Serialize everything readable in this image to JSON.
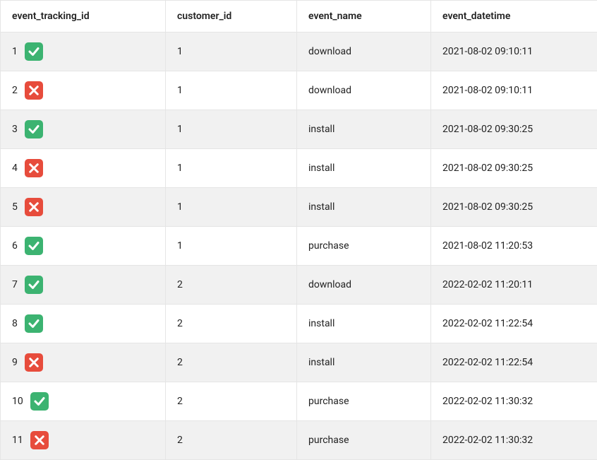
{
  "icons": {
    "check": "check-icon",
    "cross": "cross-icon"
  },
  "table": {
    "headers": [
      "event_tracking_id",
      "customer_id",
      "event_name",
      "event_datetime"
    ],
    "rows": [
      {
        "id": "1",
        "status": "check",
        "customer_id": "1",
        "event_name": "download",
        "event_datetime": "2021-08-02 09:10:11"
      },
      {
        "id": "2",
        "status": "cross",
        "customer_id": "1",
        "event_name": "download",
        "event_datetime": "2021-08-02 09:10:11"
      },
      {
        "id": "3",
        "status": "check",
        "customer_id": "1",
        "event_name": "install",
        "event_datetime": "2021-08-02 09:30:25"
      },
      {
        "id": "4",
        "status": "cross",
        "customer_id": "1",
        "event_name": "install",
        "event_datetime": "2021-08-02 09:30:25"
      },
      {
        "id": "5",
        "status": "cross",
        "customer_id": "1",
        "event_name": "install",
        "event_datetime": "2021-08-02 09:30:25"
      },
      {
        "id": "6",
        "status": "check",
        "customer_id": "1",
        "event_name": "purchase",
        "event_datetime": "2021-08-02 11:20:53"
      },
      {
        "id": "7",
        "status": "check",
        "customer_id": "2",
        "event_name": "download",
        "event_datetime": "2022-02-02 11:20:11"
      },
      {
        "id": "8",
        "status": "check",
        "customer_id": "2",
        "event_name": "install",
        "event_datetime": "2022-02-02 11:22:54"
      },
      {
        "id": "9",
        "status": "cross",
        "customer_id": "2",
        "event_name": "install",
        "event_datetime": "2022-02-02 11:22:54"
      },
      {
        "id": "10",
        "status": "check",
        "customer_id": "2",
        "event_name": "purchase",
        "event_datetime": "2022-02-02 11:30:32"
      },
      {
        "id": "11",
        "status": "cross",
        "customer_id": "2",
        "event_name": "purchase",
        "event_datetime": "2022-02-02 11:30:32"
      }
    ]
  }
}
